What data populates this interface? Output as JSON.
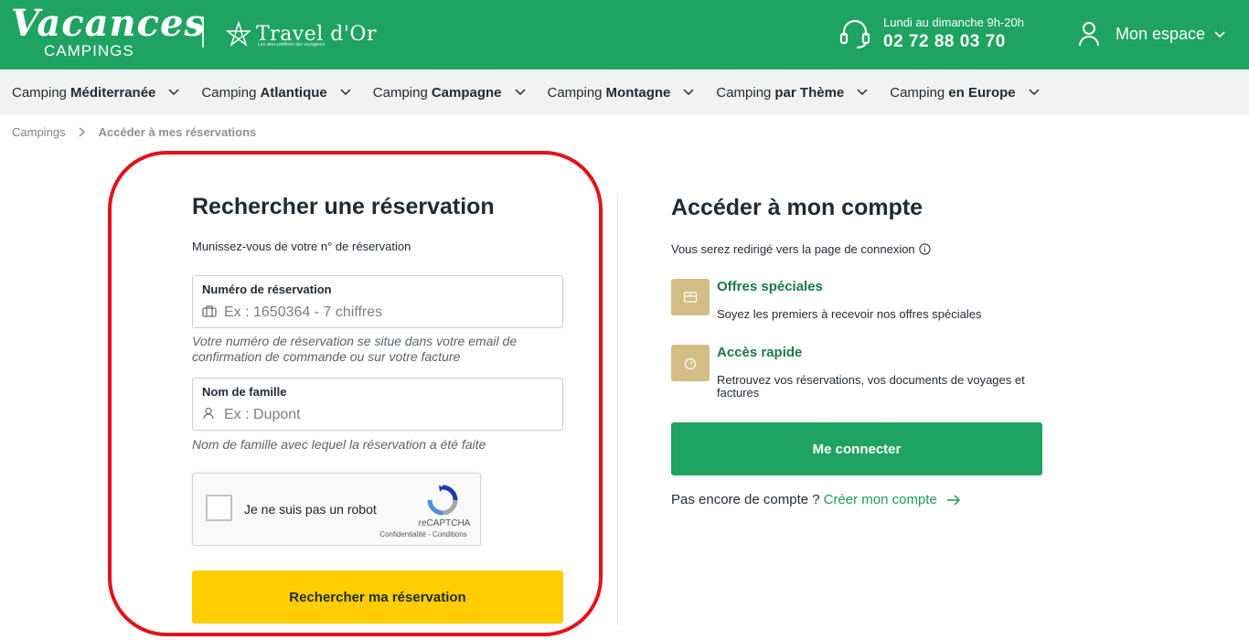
{
  "header": {
    "logo_title": "Vacances",
    "logo_subtitle": "CAMPINGS",
    "partner_name": "Travel d'Or",
    "partner_tagline": "Les sites préférés des voyageurs",
    "hours": "Lundi au dimanche 9h-20h",
    "phone": "02 72 88 03 70",
    "account_label": "Mon espace"
  },
  "nav": {
    "items": [
      {
        "prefix": "Camping",
        "bold": "Méditerranée"
      },
      {
        "prefix": "Camping",
        "bold": "Atlantique"
      },
      {
        "prefix": "Camping",
        "bold": "Campagne"
      },
      {
        "prefix": "Camping",
        "bold": "Montagne"
      },
      {
        "prefix": "Camping",
        "bold": "par Thème"
      },
      {
        "prefix": "Camping",
        "bold": "en Europe"
      }
    ]
  },
  "breadcrumb": {
    "home": "Campings",
    "current": "Accéder à mes réservations"
  },
  "search": {
    "title": "Rechercher une réservation",
    "subtitle": "Munissez-vous de votre n° de réservation",
    "booking_label": "Numéro de réservation",
    "booking_placeholder": "Ex : 1650364 - 7 chiffres",
    "booking_help": "Votre numéro de réservation se situe dans votre email de confirmation de commande ou sur votre facture",
    "name_label": "Nom de famille",
    "name_placeholder": "Ex : Dupont",
    "name_help": "Nom de famille avec lequel la réservation a été faite",
    "captcha_label": "Je ne suis pas un robot",
    "captcha_brand": "reCAPTCHA",
    "captcha_links": "Confidentialité - Conditions",
    "submit": "Rechercher ma réservation"
  },
  "account": {
    "title": "Accéder à mon compte",
    "subtitle": "Vous serez redirigé vers la page de connexion",
    "features": [
      {
        "title": "Offres spéciales",
        "desc": "Soyez les premiers à recevoir nos offres spéciales"
      },
      {
        "title": "Accès rapide",
        "desc": "Retrouvez vos réservations, vos documents de voyages et factures"
      }
    ],
    "login_button": "Me connecter",
    "no_account": "Pas encore de compte ?",
    "create_link": "Créer mon compte"
  },
  "colors": {
    "brand_green": "#1ea362",
    "accent_yellow": "#ffcd00",
    "feature_gold": "#d4bd85",
    "highlight_red": "#e1131b"
  }
}
